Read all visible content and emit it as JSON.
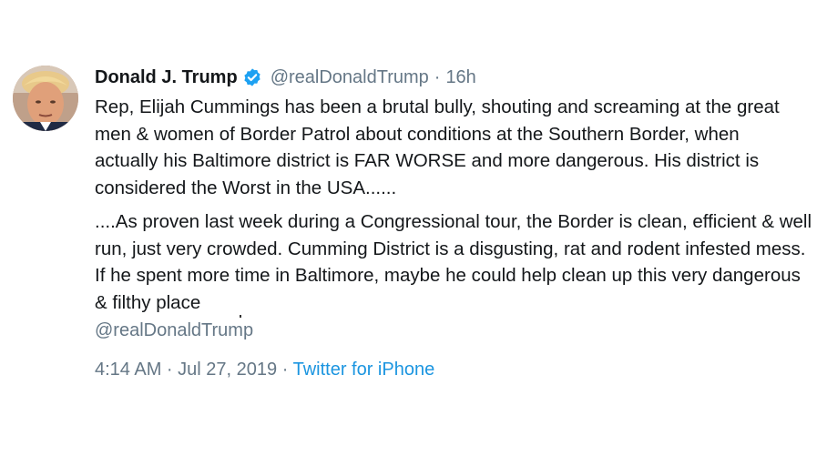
{
  "tweet": {
    "author_name": "Donald J. Trump",
    "handle": "@realDonaldTrump",
    "separator": "·",
    "relative_time": "16h",
    "text": "Rep, Elijah Cummings has been a brutal bully, shouting and screaming at the great men & women of Border Patrol about conditions at the Southern Border, when actually his Baltimore district is FAR WORSE and more dangerous. His district is considered the Worst in the USA......",
    "quoted_text": "....As proven last week during a Congressional tour, the Border is clean, efficient & well run, just very crowded. Cumming District is a disgusting, rat and rodent infested mess. If he spent more time in Baltimore, maybe he could help clean up this very dangerous & filthy place",
    "quoted_handle": "@realDonaldTrump",
    "timestamp": "4:14 AM · Jul 27, 2019",
    "meta_separator": "·",
    "source": "Twitter for iPhone",
    "verified_icon": "verified-badge-icon"
  },
  "colors": {
    "text": "#14171a",
    "secondary": "#657786",
    "link": "#1b95e0",
    "verified": "#1da1f2"
  }
}
